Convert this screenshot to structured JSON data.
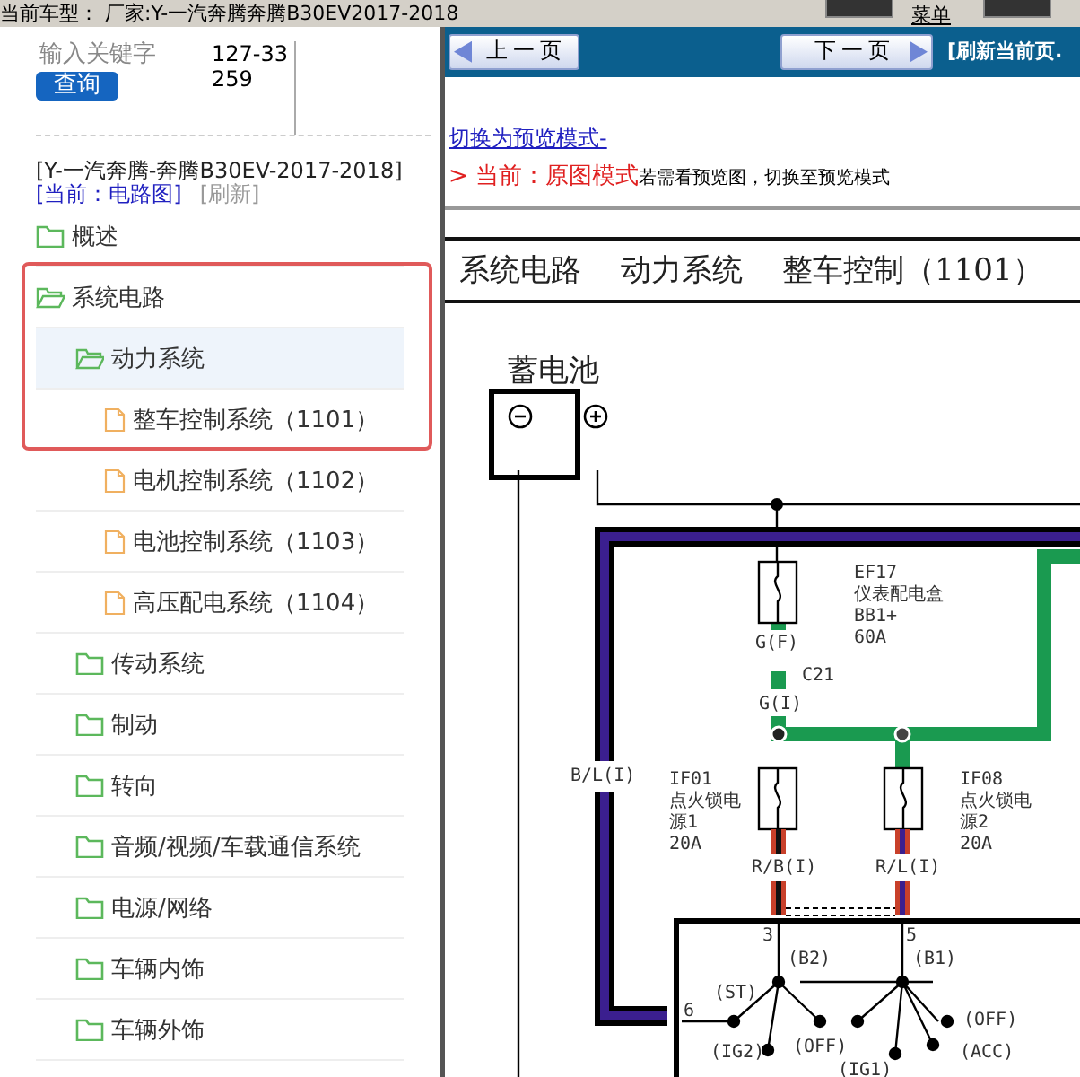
{
  "top_bar": {
    "vehicle": "当前车型： 厂家:Y-一汽奔腾奔腾B30EV2017-2018",
    "menu": "菜单"
  },
  "search": {
    "placeholder": "输入关键字",
    "code": "127-33259",
    "button": "查询"
  },
  "model": {
    "title": "[Y-一汽奔腾-奔腾B30EV-2017-2018]",
    "current": "[当前：电路图]",
    "refresh": "[刷新]"
  },
  "tree": [
    {
      "kind": "folder",
      "label": "概述",
      "expanded": false,
      "selected": false
    },
    {
      "kind": "folder",
      "label": "系统电路",
      "expanded": true,
      "selected": false,
      "children": [
        {
          "kind": "folder",
          "label": "动力系统",
          "expanded": true,
          "selected": true,
          "children": [
            {
              "kind": "file",
              "label": "整车控制系统（1101）",
              "selected": false
            },
            {
              "kind": "file",
              "label": "电机控制系统（1102）",
              "selected": false
            },
            {
              "kind": "file",
              "label": "电池控制系统（1103）",
              "selected": false
            },
            {
              "kind": "file",
              "label": "高压配电系统（1104）",
              "selected": false
            }
          ]
        },
        {
          "kind": "folder",
          "label": "传动系统",
          "expanded": false,
          "selected": false
        },
        {
          "kind": "folder",
          "label": "制动",
          "expanded": false,
          "selected": false
        },
        {
          "kind": "folder",
          "label": "转向",
          "expanded": false,
          "selected": false
        },
        {
          "kind": "folder",
          "label": "音频/视频/车载通信系统",
          "expanded": false,
          "selected": false
        },
        {
          "kind": "folder",
          "label": "电源/网络",
          "expanded": false,
          "selected": false
        },
        {
          "kind": "folder",
          "label": "车辆内饰",
          "expanded": false,
          "selected": false
        },
        {
          "kind": "folder",
          "label": "车辆外饰",
          "expanded": false,
          "selected": false
        }
      ]
    }
  ],
  "nav": {
    "prev": "上一页",
    "next": "下一页",
    "refresh": "[刷新当前页."
  },
  "mode": {
    "link": "切换为预览模式-",
    "status": "> 当前：原图模式",
    "hint": "若需看预览图，切换至预览模式"
  },
  "breadcrumb": [
    "系统电路",
    "动力系统",
    "整车控制（1101）"
  ],
  "diagram": {
    "battery": "蓄电池",
    "labels": [
      {
        "lines": [
          "EF17",
          "仪表配电盒",
          "BB1+",
          "60A"
        ]
      },
      {
        "lines": [
          "G(F)"
        ]
      },
      {
        "lines": [
          "G(I)"
        ]
      },
      {
        "lines": [
          "C21"
        ]
      },
      {
        "lines": [
          "B/L(I)"
        ]
      },
      {
        "lines": [
          "IF01",
          "点火锁电",
          "源1",
          "20A"
        ]
      },
      {
        "lines": [
          "IF08",
          "点火锁电",
          "源2",
          "20A"
        ]
      },
      {
        "lines": [
          "R/B(I)"
        ]
      },
      {
        "lines": [
          "R/L(I)"
        ]
      },
      {
        "lines": [
          "3"
        ]
      },
      {
        "lines": [
          "5"
        ]
      },
      {
        "lines": [
          "(B2)"
        ]
      },
      {
        "lines": [
          "(B1)"
        ]
      },
      {
        "lines": [
          "(ST)"
        ]
      },
      {
        "lines": [
          "6"
        ]
      },
      {
        "lines": [
          "(IG2)"
        ]
      },
      {
        "lines": [
          "(OFF)"
        ]
      },
      {
        "lines": [
          "(OFF)"
        ]
      },
      {
        "lines": [
          "(ACC)"
        ]
      },
      {
        "lines": [
          "(IG1)"
        ]
      }
    ]
  }
}
